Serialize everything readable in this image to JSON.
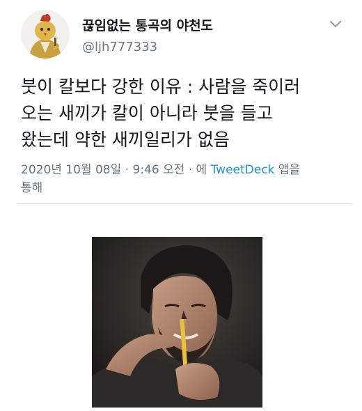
{
  "header": {
    "display_name": "끊임없는 통곡의 야천도",
    "handle": "@ljh777333",
    "avatar_icon": "avatar-cartoon-icon",
    "menu_icon": "chevron-down-icon"
  },
  "tweet": {
    "lines": [
      "붓이 칼보다 강한 이유 : 사람을 죽이러",
      "오는 새끼가 칼이 아니라 붓을 들고",
      "왔는데 약한 새끼일리가 없음"
    ]
  },
  "meta": {
    "timestamp": "2020년 10월 08일 · 9:46 오전 · 에",
    "app": "TweetDeck",
    "suffix": "앱을",
    "line2": "통해"
  },
  "media": {
    "description_icon": "photo-man-holding-pencil-icon"
  },
  "colors": {
    "text": "#14171a",
    "secondary": "#657786",
    "link": "#1b95e0",
    "divider": "#d9dee2"
  }
}
